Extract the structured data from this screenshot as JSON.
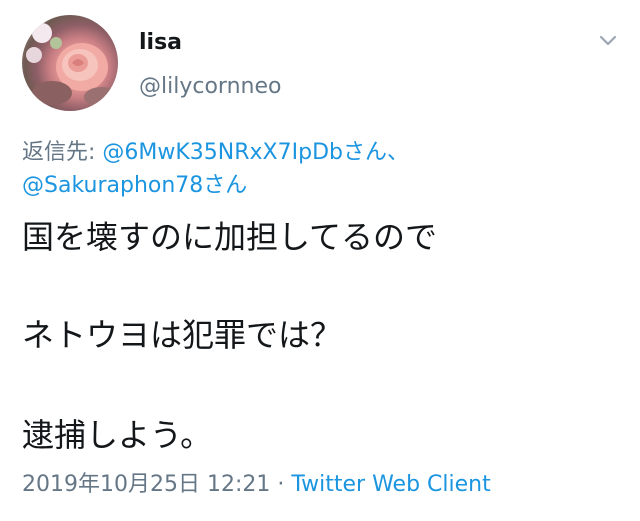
{
  "tweet": {
    "display_name": "lisa",
    "handle": "@lilycornneo",
    "reply_prefix": "返信先: ",
    "mentions": [
      "@6MwK35NRxX7IpDbさん、",
      "@Sakuraphon78さん"
    ],
    "lines": [
      "国を壊すのに加担してるので",
      "ネトウヨは犯罪では？",
      "逮捕しよう。"
    ],
    "timestamp": "2019年10月25日 12:21",
    "separator": " · ",
    "client": "Twitter Web Client"
  },
  "icons": {
    "avatar": "rose-avatar",
    "menu": "chevron-down-icon"
  },
  "colors": {
    "link": "#1b95e0",
    "secondary": "#657786",
    "text": "#14171a"
  }
}
